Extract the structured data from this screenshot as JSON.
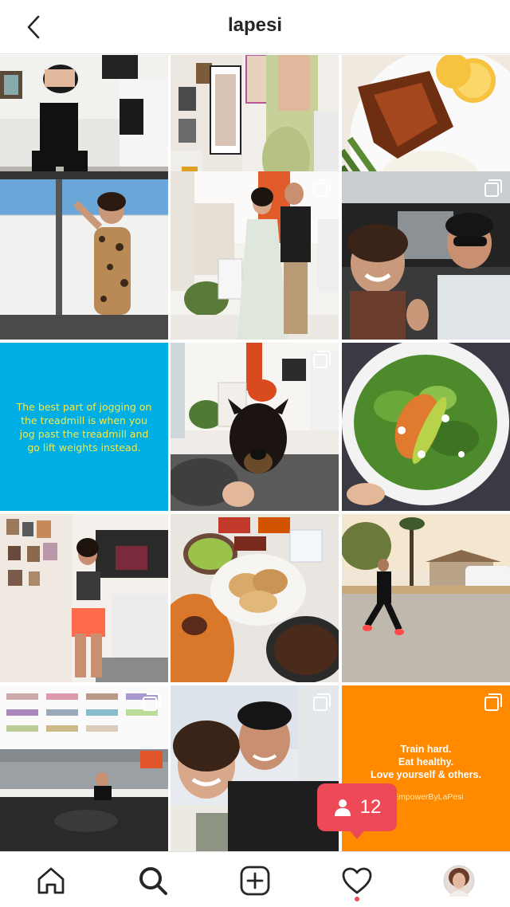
{
  "header": {
    "title": "lapesi",
    "back_icon": "chevron-left-icon"
  },
  "grid": {
    "tiles": [
      {
        "subject": "workout photo"
      },
      {
        "subject": "outfit photo"
      },
      {
        "subject": "salmon dish"
      },
      {
        "subject": "leopard bodysuit photo",
        "multi": false
      },
      {
        "subject": "couple photo",
        "multi": true
      },
      {
        "subject": "car selfie",
        "multi": true
      },
      {
        "subject": "quote card",
        "text": "The best part of jogging on the treadmill is when you jog past the treadmill and go lift weights instead."
      },
      {
        "subject": "dog photo",
        "multi": true
      },
      {
        "subject": "salad plate"
      },
      {
        "subject": "mirror selfie"
      },
      {
        "subject": "taco spread"
      },
      {
        "subject": "street workout"
      },
      {
        "subject": "living room workout",
        "multi": true
      },
      {
        "subject": "couple selfie",
        "multi": true
      },
      {
        "subject": "motto card",
        "multi": true,
        "text_lines": [
          "Train hard.",
          "Eat healthy.",
          "Love yourself & others."
        ],
        "hashtag": "#EmpowerByLaPesi"
      }
    ]
  },
  "notification": {
    "count": "12",
    "icon": "person-icon",
    "color": "#ed4956"
  },
  "tabbar": {
    "items": [
      "home-icon",
      "search-icon",
      "add-icon",
      "heart-icon",
      "profile-avatar"
    ]
  },
  "colors": {
    "quote_bg": "#00aee6",
    "quote_text": "#f5e94a",
    "motto_bg": "#ff8a00"
  }
}
